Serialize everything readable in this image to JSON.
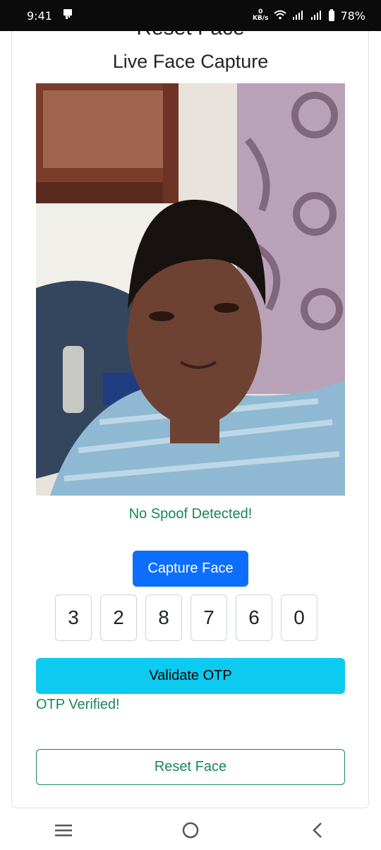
{
  "status_bar": {
    "time": "9:41",
    "net_speed_value": "0",
    "net_speed_unit": "KB/s",
    "battery": "78%"
  },
  "page": {
    "cut_title": "Reset Face",
    "subtitle": "Live Face Capture",
    "spoof_status": "No Spoof Detected!",
    "capture_label": "Capture Face",
    "otp_digits": [
      "3",
      "2",
      "8",
      "7",
      "6",
      "0"
    ],
    "validate_label": "Validate OTP",
    "otp_status": "OTP Verified!",
    "reset_label": "Reset Face"
  },
  "colors": {
    "primary": "#0d6efd",
    "info": "#0dcaf0",
    "success": "#198754"
  }
}
